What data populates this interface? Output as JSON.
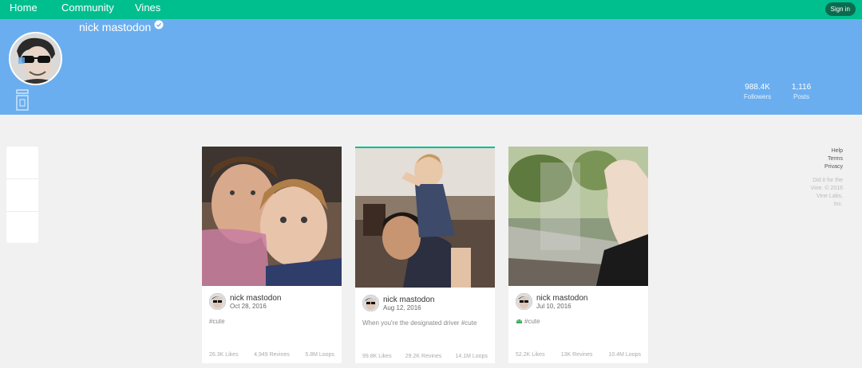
{
  "nav": {
    "home": "Home",
    "community": "Community",
    "vines": "Vines",
    "signin": "Sign in"
  },
  "profile": {
    "name": "nick mastodon",
    "followers_value": "988.4K",
    "followers_label": "Followers",
    "posts_value": "1,116",
    "posts_label": "Posts"
  },
  "posts": [
    {
      "user": "nick mastodon",
      "date": "Oct 28, 2016",
      "caption": "#cute",
      "likes": "26.3K Likes",
      "revines": "4,949 Revines",
      "loops": "5.8M Loops"
    },
    {
      "user": "nick mastodon",
      "date": "Aug 12, 2016",
      "caption": "When you're the designated driver #cute",
      "likes": "99.8K Likes",
      "revines": "29.2K Revines",
      "loops": "14.1M Loops"
    },
    {
      "user": "nick mastodon",
      "date": "Jul 10, 2016",
      "caption": "#cute",
      "likes": "52.2K Likes",
      "revines": "13K Revines",
      "loops": "10.4M Loops"
    }
  ],
  "sidebar": {
    "help": "Help",
    "terms": "Terms",
    "privacy": "Privacy",
    "credit": "Did it for the Vine. © 2016 Vine Labs, Inc."
  },
  "colors": {
    "nav": "#00bf8f",
    "banner": "#6aaeef",
    "background": "#f1f1f1"
  }
}
